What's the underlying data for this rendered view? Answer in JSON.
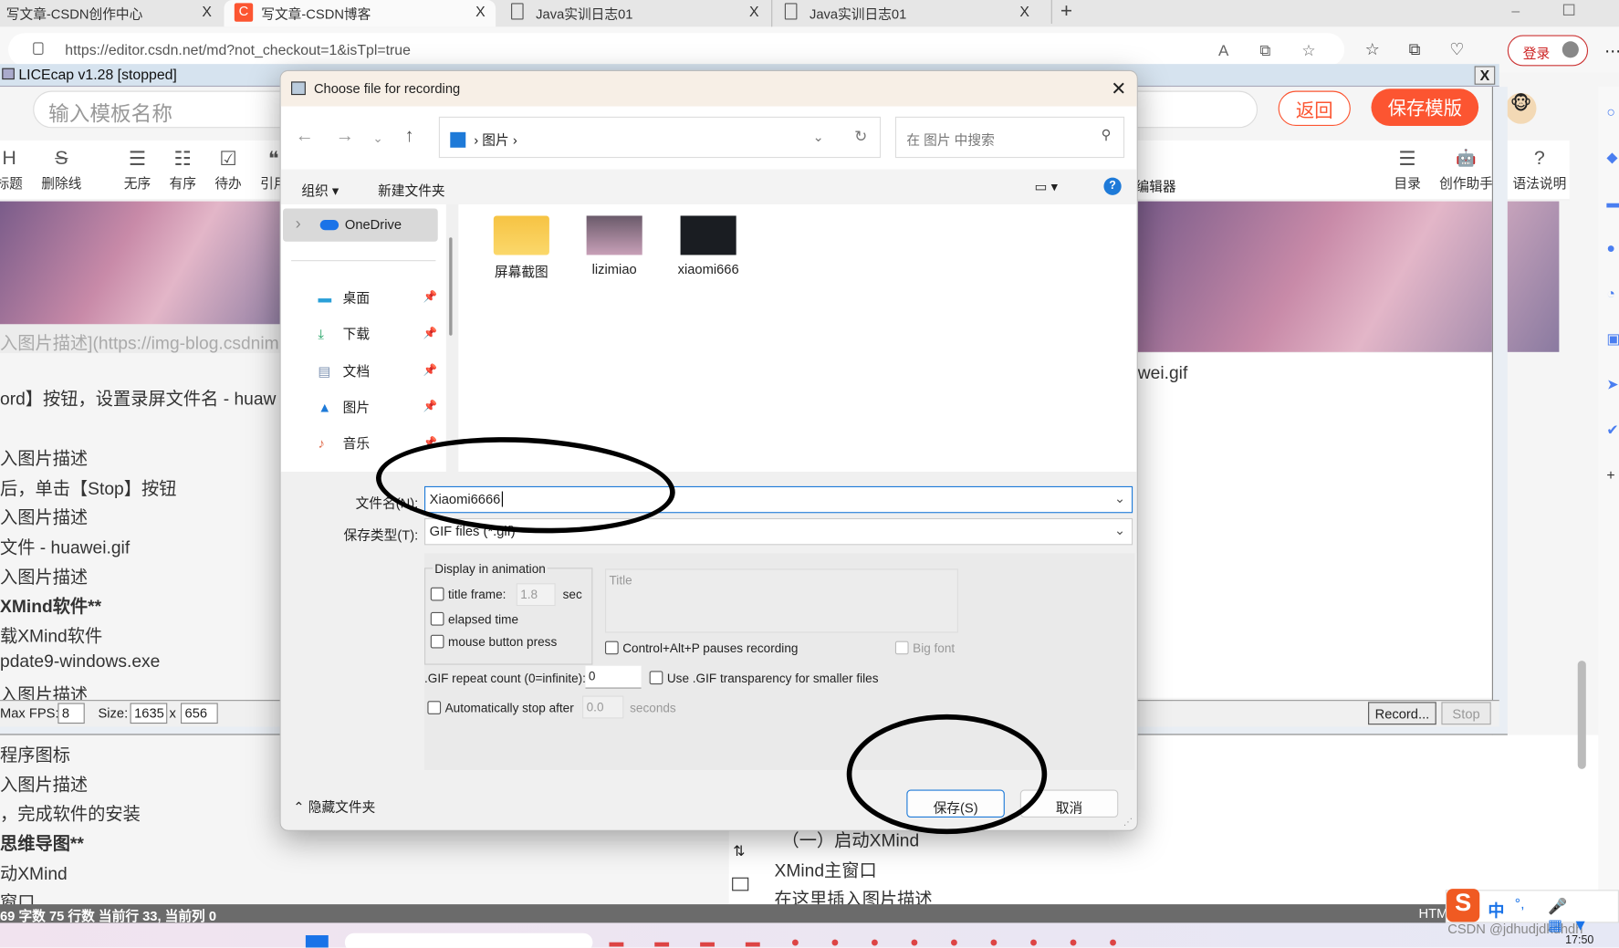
{
  "browser": {
    "tabs": [
      {
        "label": "写文章-CSDN创作中心"
      },
      {
        "label": "写文章-CSDN博客",
        "active": true
      },
      {
        "label": "Java实训日志01"
      },
      {
        "label": "Java实训日志01"
      }
    ],
    "close_glyph": "X",
    "new_tab": "+",
    "url": "https://editor.csdn.net/md?not_checkout=1&isTpl=true",
    "login_label": "登录"
  },
  "licecap": {
    "title": "LICEcap v1.28 [stopped]",
    "close": "X",
    "max_fps_label": "Max FPS:",
    "max_fps": "8",
    "size_label": "Size:",
    "width": "1635",
    "x_label": "x",
    "height": "656",
    "record_label": "Record...",
    "stop_label": "Stop"
  },
  "csdn": {
    "template_placeholder": "输入模板名称",
    "back_label": "返回",
    "save_template_label": "保存模版",
    "accent": "#fc5531",
    "toolbar": [
      {
        "icon": "H",
        "label": "标题"
      },
      {
        "icon": "S",
        "label": "删除线"
      },
      {
        "icon": "☰",
        "label": "无序"
      },
      {
        "icon": "☷",
        "label": "有序"
      },
      {
        "icon": "☑",
        "label": "待办"
      },
      {
        "icon": "❝",
        "label": "引用"
      }
    ],
    "toolbar_partial": "编辑器",
    "toolbar_right": [
      {
        "icon": "☰",
        "label": "目录"
      },
      {
        "icon": "🤖",
        "label": "创作助手"
      },
      {
        "icon": "?",
        "label": "语法说明"
      }
    ],
    "editor_lines_top": [
      "入图片描述](https://img-blog.csdnim",
      "ord】按钮，设置录屏文件名 - huaw",
      "入图片描述",
      "后，单击【Stop】按钮",
      "入图片描述",
      "文件 - huawei.gif",
      "入图片描述",
      "XMind软件**",
      "载XMind软件",
      "pdate9-windows.exe",
      "入图片描述"
    ],
    "editor_lines_bottom": [
      "程序图标",
      "入图片描述",
      "，完成软件的安装",
      "思维导图**",
      "动XMind",
      "窗口"
    ],
    "preview_text": "wei.gif",
    "preview_lines": [
      "（一）启动XMind",
      "XMind主窗口",
      "在这里插入图片描述"
    ],
    "status": "69 字数   75 行数   当前行 33, 当前列 0",
    "status_right": "HTML"
  },
  "dialog": {
    "title": "Choose file for recording",
    "close": "✕",
    "breadcrumb": "图片",
    "search_placeholder": "在 图片 中搜索",
    "organize": "组织 ▾",
    "new_folder": "新建文件夹",
    "nav": {
      "onedrive": "OneDrive",
      "items": [
        "桌面",
        "下载",
        "文档",
        "图片",
        "音乐"
      ]
    },
    "files": [
      "屏幕截图",
      "lizimiao",
      "xiaomi666"
    ],
    "filename_label": "文件名(N):",
    "filename_value": "Xiaomi6666",
    "filetype_label": "保存类型(T):",
    "filetype_value": "GIF files (*.gif)",
    "display_group": "Display in animation",
    "title_frame": "title frame:",
    "title_frame_sec": "1.8",
    "sec": "sec",
    "elapsed_time": "elapsed time",
    "mouse_press": "mouse button press",
    "title_placeholder": "Title",
    "ctrl_alt_p": "Control+Alt+P pauses recording",
    "big_font": "Big font",
    "repeat_label": ".GIF repeat count (0=infinite):",
    "repeat_value": "0",
    "transparency": "Use .GIF transparency for smaller files",
    "auto_stop": "Automatically stop after",
    "auto_stop_value": "0.0",
    "seconds": "seconds",
    "hide_folders": "隐藏文件夹",
    "save": "保存(S)",
    "cancel": "取消"
  },
  "taskbar": {
    "watermark": "CSDN @jdhudjdkdhdh",
    "time": "17:50"
  },
  "ime": {
    "logo": "S",
    "mode": "中",
    "punct": "°,"
  }
}
